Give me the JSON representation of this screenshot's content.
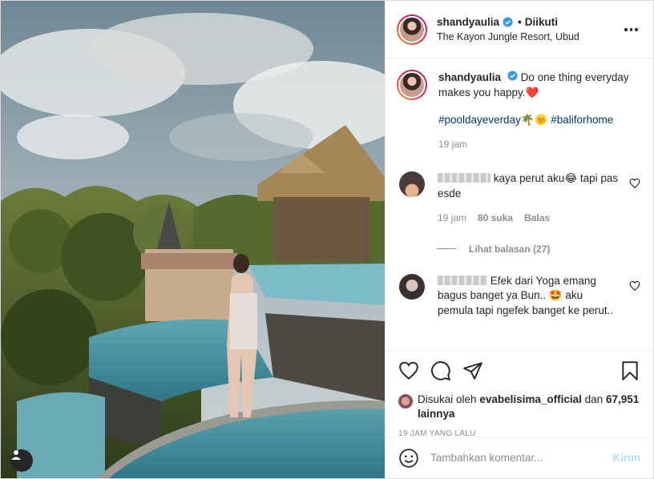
{
  "post": {
    "username": "shandyaulia",
    "separator": "•",
    "follow_state": "Diikuti",
    "location": "The Kayon Jungle Resort, Ubud"
  },
  "caption": {
    "username": "shandyaulia",
    "text": "Do one thing everyday makes you happy.",
    "emoji": "❤️",
    "hashtag1": "#pooldayeverday",
    "hashtag_emojis": "🌴🌞",
    "hashtag2": "#baliforhome",
    "time": "19 jam"
  },
  "comments": [
    {
      "text": "kaya perut aku😂 tapi pas esde",
      "time": "19 jam",
      "likes": "80 suka",
      "reply": "Balas"
    },
    {
      "text": "Efek dari Yoga emang bagus banget ya Bun.. 🤩 aku pemula tapi ngefek banget ke perut.."
    }
  ],
  "view_replies": "Lihat balasan (27)",
  "liked_by": {
    "prefix": "Disukai oleh",
    "user": "evabelisima_official",
    "and": "dan",
    "others": "67,951 lainnya"
  },
  "time_ago": "19 JAM YANG LALU",
  "add_comment": {
    "placeholder": "Tambahkan komentar...",
    "post_label": "Kirim"
  },
  "colors": {
    "link": "#00376b",
    "muted": "#8e8e8e",
    "post_disabled": "#b2dffc",
    "verified": "#3897f0",
    "heart": "#ed4956"
  },
  "icons": [
    "verified-badge-icon",
    "more-options-icon",
    "heart-icon",
    "comment-icon",
    "share-icon",
    "bookmark-icon",
    "emoji-icon",
    "user-tag-icon"
  ]
}
